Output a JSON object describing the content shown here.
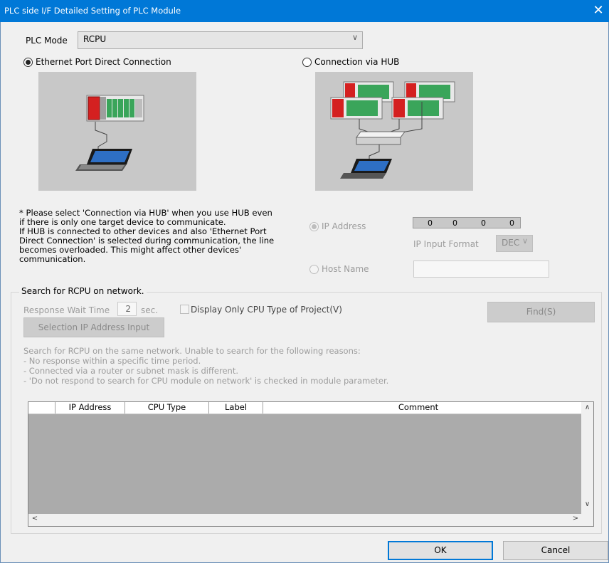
{
  "window": {
    "title": "PLC side I/F Detailed Setting of PLC Module",
    "close_glyph": "✕"
  },
  "plc_mode": {
    "label": "PLC Mode",
    "value": "RCPU",
    "dropdown_glyph": "∨"
  },
  "connection": {
    "direct_label": "Ethernet Port Direct Connection",
    "direct_selected": true,
    "hub_label": "Connection via HUB",
    "hub_selected": false
  },
  "note": {
    "lines": [
      "* Please select 'Connection via HUB' when you use HUB even",
      "if there is only one target device to communicate.",
      "If HUB is connected to other devices and also 'Ethernet Port",
      "Direct Connection' is selected during communication, the line",
      "becomes overloaded. This might affect other devices'",
      "communication."
    ]
  },
  "ip": {
    "ip_address_label": "IP Address",
    "octets": [
      "0",
      "0",
      "0",
      "0"
    ],
    "input_format_label": "IP Input Format",
    "input_format_value": "DEC",
    "host_name_label": "Host Name",
    "host_name_value": ""
  },
  "search": {
    "group_title": "Search for RCPU on network.",
    "response_wait_label": "Response Wait Time",
    "response_wait_value": "2",
    "response_wait_unit": "sec.",
    "display_only_label": "Display Only CPU Type of Project(V)",
    "find_button": "Find(S)",
    "selection_ip_button": "Selection IP Address Input",
    "message_lines": [
      "Search for RCPU on the same network. Unable to search for the following reasons:",
      "- No response within a specific time period.",
      "- Connected via a router or subnet mask is different.",
      "- 'Do not respond to search for CPU module on network' is checked in module parameter."
    ],
    "columns": [
      "",
      "IP Address",
      "CPU Type",
      "Label",
      "Comment"
    ],
    "rows": []
  },
  "scroll": {
    "up": "∧",
    "down": "∨",
    "left": "<",
    "right": ">"
  },
  "footer": {
    "ok_button": "OK",
    "cancel_button": "Cancel"
  },
  "icons": {
    "plc_rack": "plc-rack-icon",
    "laptop": "laptop-icon",
    "hub": "network-hub-icon"
  },
  "colors": {
    "titlebar": "#0078d7",
    "dialog_bg": "#f0f0f0",
    "picture_bg": "#c8c8c8",
    "plc_cpu_red": "#d42020",
    "plc_module_green": "#3aa55a"
  }
}
